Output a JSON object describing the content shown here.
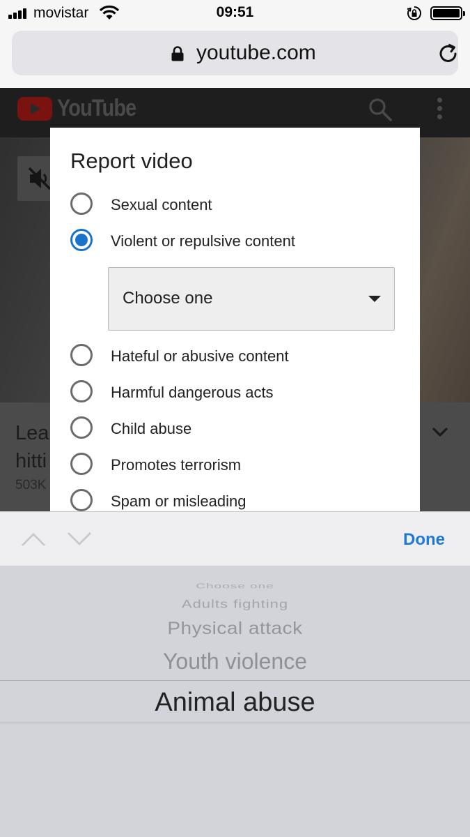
{
  "status_bar": {
    "carrier": "movistar",
    "time": "09:51",
    "battery_level": 1.0
  },
  "browser": {
    "url": "youtube.com"
  },
  "youtube_page": {
    "logo_text": "YouTube",
    "title_partial": "Lea hitti",
    "views_partial": "503K"
  },
  "dialog": {
    "title": "Report video",
    "options": [
      {
        "label": "Sexual content",
        "checked": false
      },
      {
        "label": "Violent or repulsive content",
        "checked": true
      },
      {
        "label": "Hateful or abusive content",
        "checked": false
      },
      {
        "label": "Harmful dangerous acts",
        "checked": false
      },
      {
        "label": "Child abuse",
        "checked": false
      },
      {
        "label": "Promotes terrorism",
        "checked": false
      },
      {
        "label": "Spam or misleading",
        "checked": false
      }
    ],
    "select": {
      "value": "Choose one"
    }
  },
  "picker_toolbar": {
    "done_label": "Done"
  },
  "picker": {
    "items_above": [
      "Choose one",
      "Adults fighting",
      "Physical attack",
      "Youth violence"
    ],
    "selected": "Animal abuse"
  },
  "colors": {
    "accent": "#1a73c9",
    "done": "#1e7ad6"
  }
}
